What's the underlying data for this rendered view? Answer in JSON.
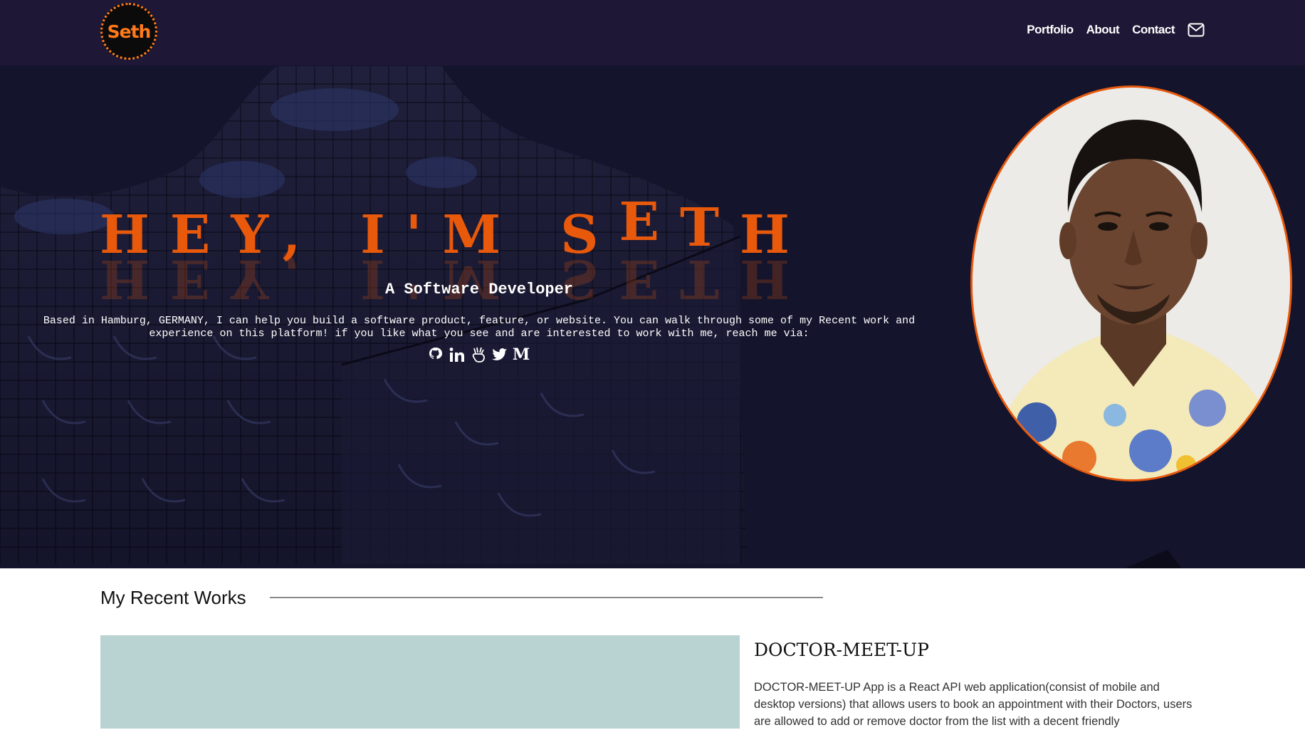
{
  "navbar": {
    "logo_text": "Seth",
    "links": [
      "Portfolio",
      "About",
      "Contact"
    ],
    "mail_icon": "envelope-icon"
  },
  "hero": {
    "title_part1": "HEY, I'M S",
    "title_part2": "E",
    "title_part3": "T",
    "title_part4": "H",
    "subtitle": "A Software Developer",
    "description": "Based in Hamburg, GERMANY, I can help you build a software product, feature, or website. You can walk through some of my Recent work and experience on this platform! if you like what you see and are interested to work with me, reach me via:",
    "social_icons": [
      "github-icon",
      "linkedin-icon",
      "angellist-icon",
      "twitter-icon",
      "medium-icon"
    ],
    "medium_glyph": "M",
    "accent_color": "#e8590c"
  },
  "recent_works": {
    "heading": "My Recent Works",
    "project": {
      "title": "DOCTOR-MEET-UP",
      "description": "DOCTOR-MEET-UP App is a React API web application(consist of mobile and desktop versions) that allows users to book an appointment with their Doctors, users are allowed to add or remove doctor from the list with a decent friendly"
    }
  }
}
